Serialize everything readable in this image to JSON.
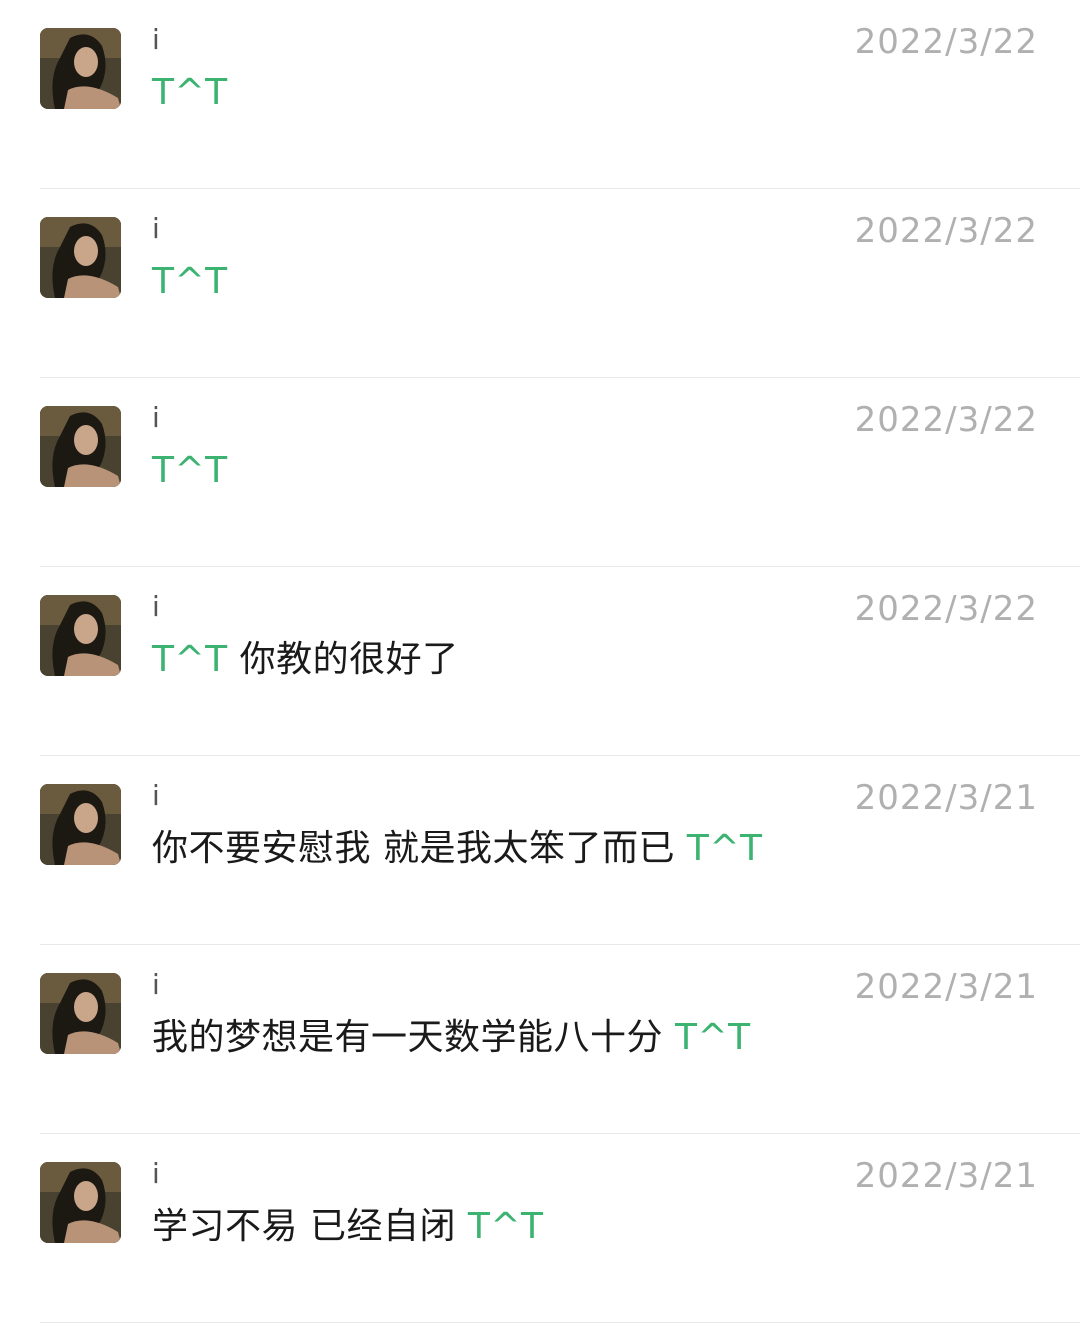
{
  "colors": {
    "highlight": "#3cb371",
    "date": "#b0b0b0",
    "divider": "#e9e9e9"
  },
  "messages": [
    {
      "sender": "i",
      "date": "2022/3/22",
      "parts": [
        {
          "text": "T^T",
          "highlight": true
        }
      ]
    },
    {
      "sender": "i",
      "date": "2022/3/22",
      "parts": [
        {
          "text": "T^T",
          "highlight": true
        }
      ]
    },
    {
      "sender": "i",
      "date": "2022/3/22",
      "parts": [
        {
          "text": "T^T",
          "highlight": true
        }
      ]
    },
    {
      "sender": "i",
      "date": "2022/3/22",
      "parts": [
        {
          "text": "T^T",
          "highlight": true
        },
        {
          "text": " 你教的很好了",
          "highlight": false
        }
      ]
    },
    {
      "sender": "i",
      "date": "2022/3/21",
      "parts": [
        {
          "text": "你不要安慰我 就是我太笨了而已 ",
          "highlight": false
        },
        {
          "text": "T^T",
          "highlight": true
        }
      ]
    },
    {
      "sender": "i",
      "date": "2022/3/21",
      "parts": [
        {
          "text": "我的梦想是有一天数学能八十分 ",
          "highlight": false
        },
        {
          "text": "T^T",
          "highlight": true
        }
      ]
    },
    {
      "sender": "i",
      "date": "2022/3/21",
      "parts": [
        {
          "text": "学习不易 已经自闭 ",
          "highlight": false
        },
        {
          "text": "T^T",
          "highlight": true
        }
      ]
    }
  ]
}
